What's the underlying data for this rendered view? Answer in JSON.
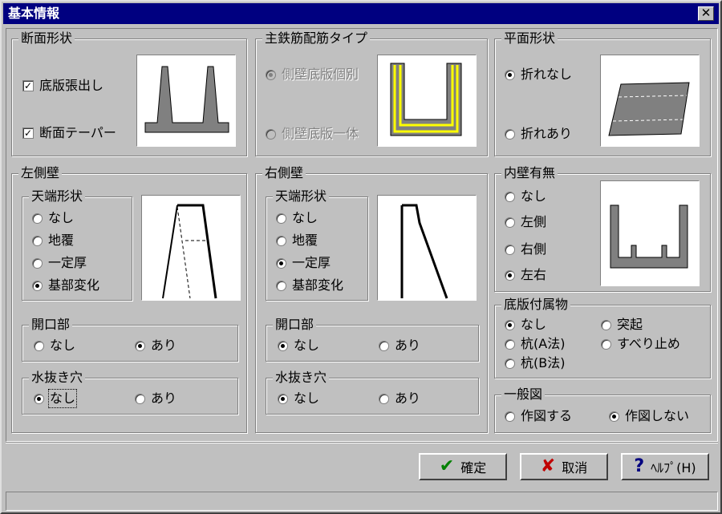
{
  "window": {
    "title": "基本情報",
    "close_label": "✕"
  },
  "cross_section": {
    "label": "断面形状",
    "options": [
      {
        "label": "底版張出し",
        "checked": true
      },
      {
        "label": "断面テーパー",
        "checked": true
      }
    ]
  },
  "rebar_type": {
    "label": "主鉄筋配筋タイプ",
    "options": [
      {
        "label": "側壁底版個別",
        "selected": true
      },
      {
        "label": "側壁底版一体",
        "selected": false
      }
    ]
  },
  "plan_shape": {
    "label": "平面形状",
    "options": [
      {
        "label": "折れなし",
        "selected": true
      },
      {
        "label": "折れあり",
        "selected": false
      }
    ]
  },
  "left_wall": {
    "label": "左側壁",
    "top_shape": {
      "label": "天端形状",
      "options": [
        {
          "label": "なし",
          "selected": false
        },
        {
          "label": "地覆",
          "selected": false
        },
        {
          "label": "一定厚",
          "selected": false
        },
        {
          "label": "基部変化",
          "selected": true
        }
      ]
    },
    "opening": {
      "label": "開口部",
      "options": [
        {
          "label": "なし",
          "selected": false
        },
        {
          "label": "あり",
          "selected": true
        }
      ]
    },
    "drain_hole": {
      "label": "水抜き穴",
      "options": [
        {
          "label": "なし",
          "selected": true
        },
        {
          "label": "あり",
          "selected": false
        }
      ]
    }
  },
  "right_wall": {
    "label": "右側壁",
    "top_shape": {
      "label": "天端形状",
      "options": [
        {
          "label": "なし",
          "selected": false
        },
        {
          "label": "地覆",
          "selected": false
        },
        {
          "label": "一定厚",
          "selected": true
        },
        {
          "label": "基部変化",
          "selected": false
        }
      ]
    },
    "opening": {
      "label": "開口部",
      "options": [
        {
          "label": "なし",
          "selected": true
        },
        {
          "label": "あり",
          "selected": false
        }
      ]
    },
    "drain_hole": {
      "label": "水抜き穴",
      "options": [
        {
          "label": "なし",
          "selected": true
        },
        {
          "label": "あり",
          "selected": false
        }
      ]
    }
  },
  "inner_wall": {
    "label": "内壁有無",
    "options": [
      {
        "label": "なし",
        "selected": false
      },
      {
        "label": "左側",
        "selected": false
      },
      {
        "label": "右側",
        "selected": false
      },
      {
        "label": "左右",
        "selected": true
      }
    ]
  },
  "base_attachment": {
    "label": "底版付属物",
    "options": [
      {
        "label": "なし",
        "selected": true
      },
      {
        "label": "突起",
        "selected": false
      },
      {
        "label": "杭(A法)",
        "selected": false
      },
      {
        "label": "すべり止め",
        "selected": false
      },
      {
        "label": "杭(B法)",
        "selected": false
      }
    ]
  },
  "general_drawing": {
    "label": "一般図",
    "options": [
      {
        "label": "作図する",
        "selected": false
      },
      {
        "label": "作図しない",
        "selected": true
      }
    ]
  },
  "buttons": {
    "ok": {
      "label": "確定",
      "icon": "check-icon",
      "color": "#008000"
    },
    "cancel": {
      "label": "取消",
      "icon": "x-icon",
      "color": "#c00000"
    },
    "help": {
      "label": "ﾍﾙﾌﾟ(H)",
      "icon": "question-icon",
      "color": "#000080"
    }
  }
}
